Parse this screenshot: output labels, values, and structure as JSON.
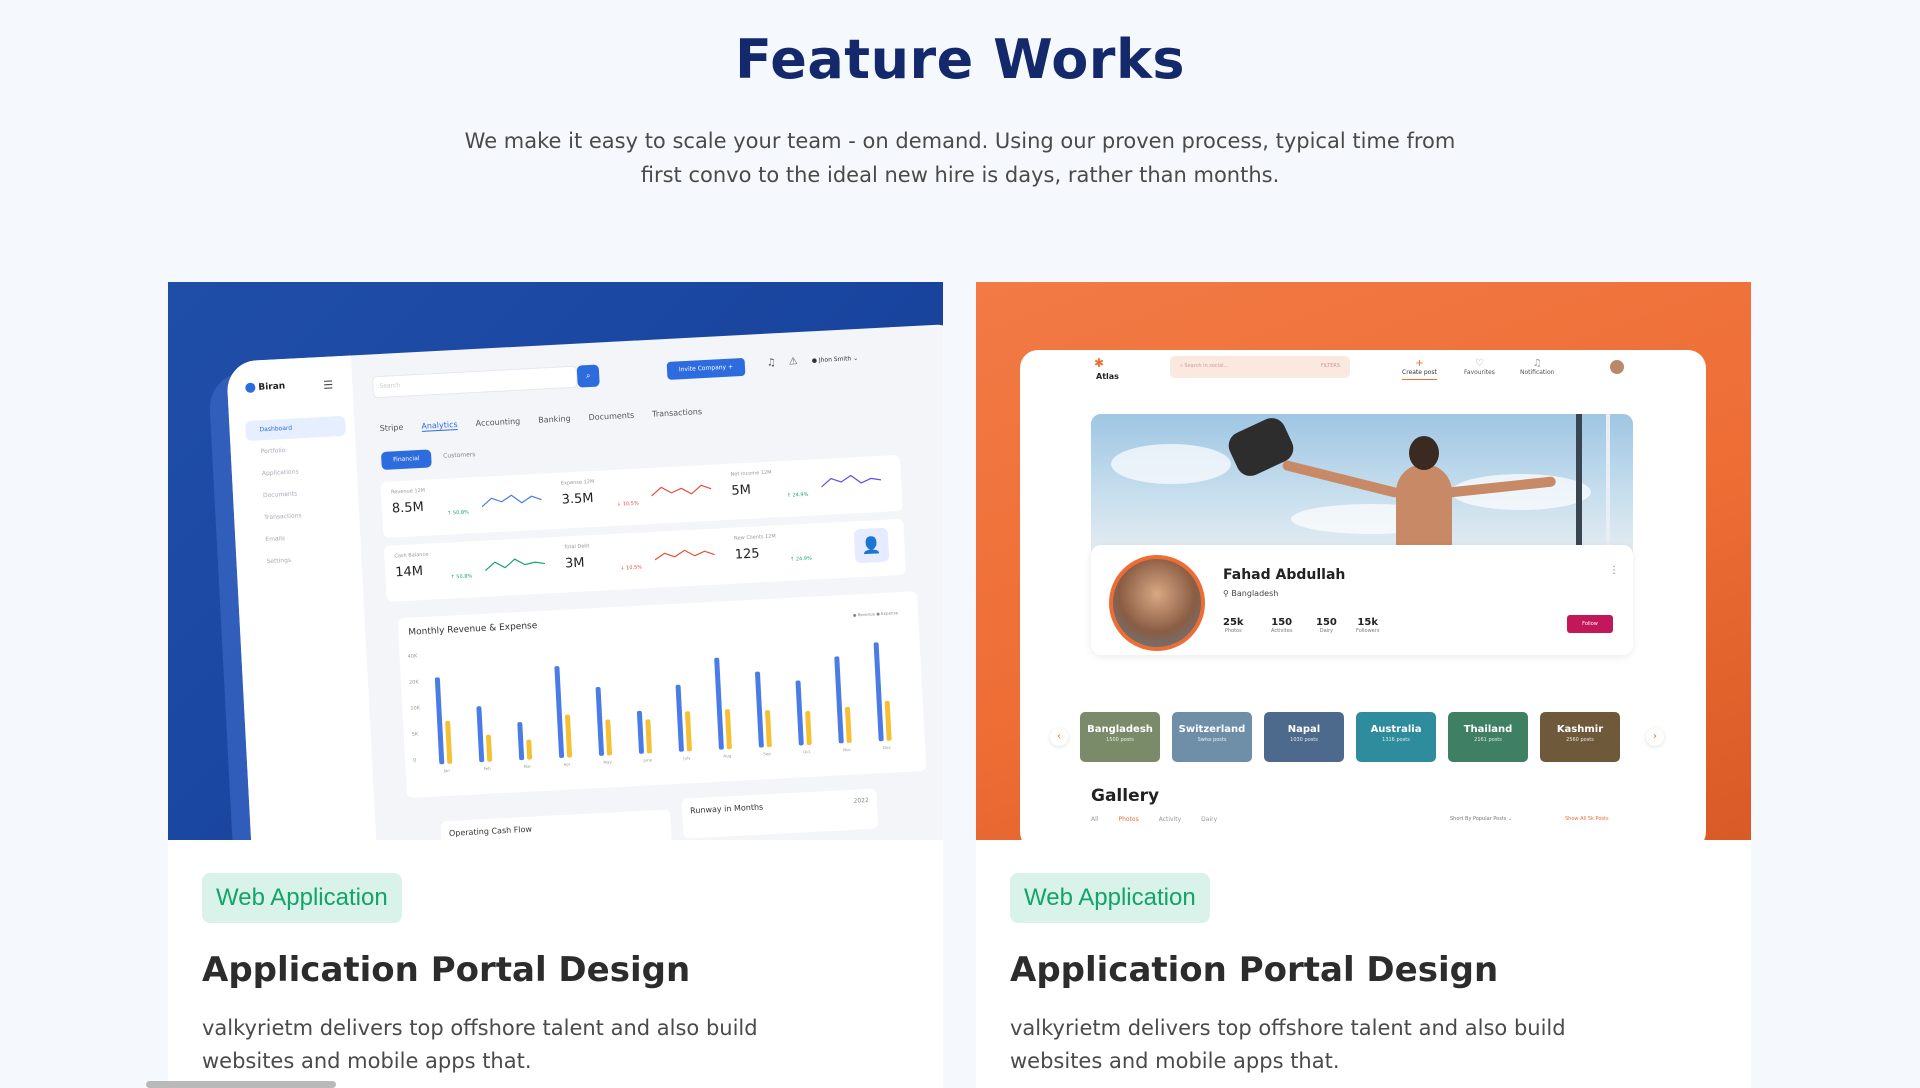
{
  "section": {
    "title": "Feature Works",
    "subtitle": "We make it easy to scale your team - on demand. Using our proven process, typical time from first convo to the ideal new hire is days, rather than months."
  },
  "cards": [
    {
      "tag": "Web Application",
      "title": "Application Portal Design",
      "description": "valkyrietm delivers top offshore talent and  also build websites and mobile apps that.",
      "mock": {
        "brand": "Biran",
        "menu_icon": "hamburger-icon",
        "sidebar": [
          "Dashboard",
          "Portfolio",
          "Applications",
          "Documents",
          "Transactions",
          "Emails",
          "Settings"
        ],
        "search_placeholder": "Search",
        "invite_label": "Invite Company  +",
        "user_name": "Jhon Smith",
        "tabs": [
          "Stripe",
          "Analytics",
          "Accounting",
          "Banking",
          "Documents",
          "Transactions"
        ],
        "pill_active": "Financial",
        "pill_inactive": "Customers",
        "stats": [
          {
            "label": "Revenue 12M",
            "value": "8.5M",
            "change": "↑ 50.8%",
            "trend": "up"
          },
          {
            "label": "Expense 12M",
            "value": "3.5M",
            "change": "↓ 10.5%",
            "trend": "down"
          },
          {
            "label": "Net Income 12M",
            "value": "5M",
            "change": "↑ 24.9%",
            "trend": "up"
          },
          {
            "label": "Cash Balance",
            "value": "14M",
            "change": "↑ 50.8%",
            "trend": "up"
          },
          {
            "label": "Total Debt",
            "value": "3M",
            "change": "↓ 10.5%",
            "trend": "down"
          },
          {
            "label": "New Clients 12M",
            "value": "125",
            "change": "↑ 24.9%",
            "trend": "up"
          }
        ],
        "chart_title": "Monthly Revenue & Expense",
        "legend": "● Revenue  ● Expense",
        "y_ticks": [
          "40K",
          "20K",
          "10K",
          "5K",
          "0"
        ],
        "months": [
          "Jan",
          "Feb",
          "Mar",
          "Apr",
          "May",
          "June",
          "July",
          "Aug",
          "Sep",
          "Oct",
          "Nov",
          "Dec"
        ],
        "revenue": [
          0.78,
          0.5,
          0.34,
          0.82,
          0.62,
          0.38,
          0.6,
          0.82,
          0.68,
          0.58,
          0.78,
          0.88
        ],
        "expense": [
          0.38,
          0.24,
          0.18,
          0.38,
          0.32,
          0.3,
          0.36,
          0.36,
          0.33,
          0.3,
          0.32,
          0.36
        ],
        "cashflow_title": "Operating Cash Flow",
        "runway_title": "Runway in Months",
        "year": "2022",
        "colors": {
          "revenue": "#4a7ce8",
          "expense": "#f6c035",
          "accent": "#2d6cdf"
        }
      }
    },
    {
      "tag": "Web Application",
      "title": "Application Portal Design",
      "description": "valkyrietm delivers top offshore talent and  also build websites and mobile apps that.",
      "mock": {
        "brand": "Atlas",
        "search_placeholder": "Search in social...",
        "search_filters": "FILTERS",
        "nav": [
          "Create post",
          "Favourites",
          "Notification"
        ],
        "profile": {
          "name": "Fahad Abdullah",
          "location": "Bangladesh",
          "stats": [
            {
              "n": "25k",
              "l": "Photos"
            },
            {
              "n": "150",
              "l": "Activites"
            },
            {
              "n": "150",
              "l": "Dairy"
            },
            {
              "n": "15k",
              "l": "Followers"
            }
          ],
          "follow_label": "Follow"
        },
        "places": [
          {
            "name": "Bangladesh",
            "sub": "1500 posts",
            "color": "#7a8b6a"
          },
          {
            "name": "Switzerland",
            "sub": "Swiss posts",
            "color": "#6f8fa8"
          },
          {
            "name": "Napal",
            "sub": "1030 posts",
            "color": "#4d6a8c"
          },
          {
            "name": "Australia",
            "sub": "1316 posts",
            "color": "#2f8c9d"
          },
          {
            "name": "Thailand",
            "sub": "2161 posts",
            "color": "#3f7f63"
          },
          {
            "name": "Kashmir",
            "sub": "2560 posts",
            "color": "#6e5a3a"
          }
        ],
        "gallery_title": "Gallery",
        "gallery_tabs": [
          "All",
          "Photos",
          "Activity",
          "Dairy"
        ],
        "sort_label": "Short By  Popular Posts ⌄",
        "show_all": "Show All 5k Posts",
        "colors": {
          "accent": "#ee6d35",
          "follow": "#c2185b"
        }
      }
    }
  ]
}
